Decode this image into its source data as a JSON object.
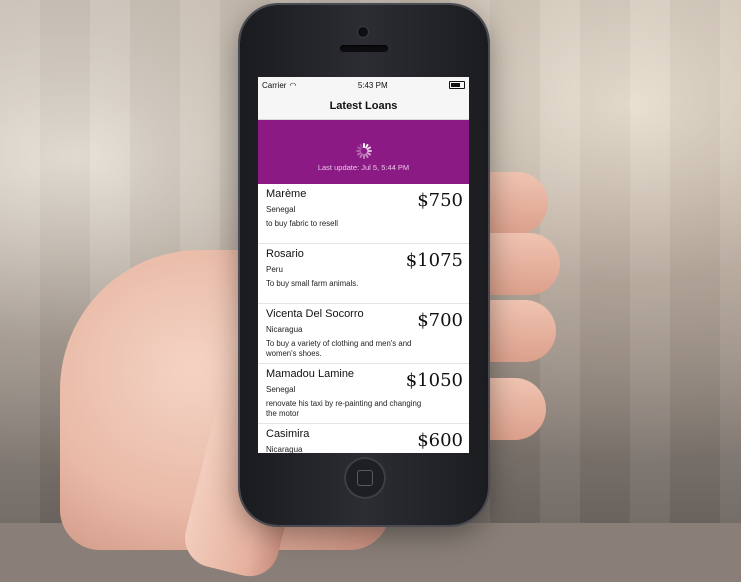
{
  "status_bar": {
    "carrier": "Carrier",
    "time": "5:43 PM"
  },
  "nav": {
    "title": "Latest Loans"
  },
  "refresh": {
    "last_update": "Last update: Jul 5, 5:44 PM",
    "color": "#8c1a85"
  },
  "loans": [
    {
      "name": "Marème",
      "country": "Senegal",
      "use": "to buy fabric to resell",
      "amount": "$750"
    },
    {
      "name": "Rosario",
      "country": "Peru",
      "use": "To buy small farm animals.",
      "amount": "$1075"
    },
    {
      "name": "Vicenta Del Socorro",
      "country": "Nicaragua",
      "use": "To buy a variety of clothing and men's and women's shoes.",
      "amount": "$700"
    },
    {
      "name": "Mamadou Lamine",
      "country": "Senegal",
      "use": "renovate his taxi by re-painting and changing the motor",
      "amount": "$1050"
    },
    {
      "name": "Casimira",
      "country": "Nicaragua",
      "use": "",
      "amount": "$600"
    }
  ]
}
